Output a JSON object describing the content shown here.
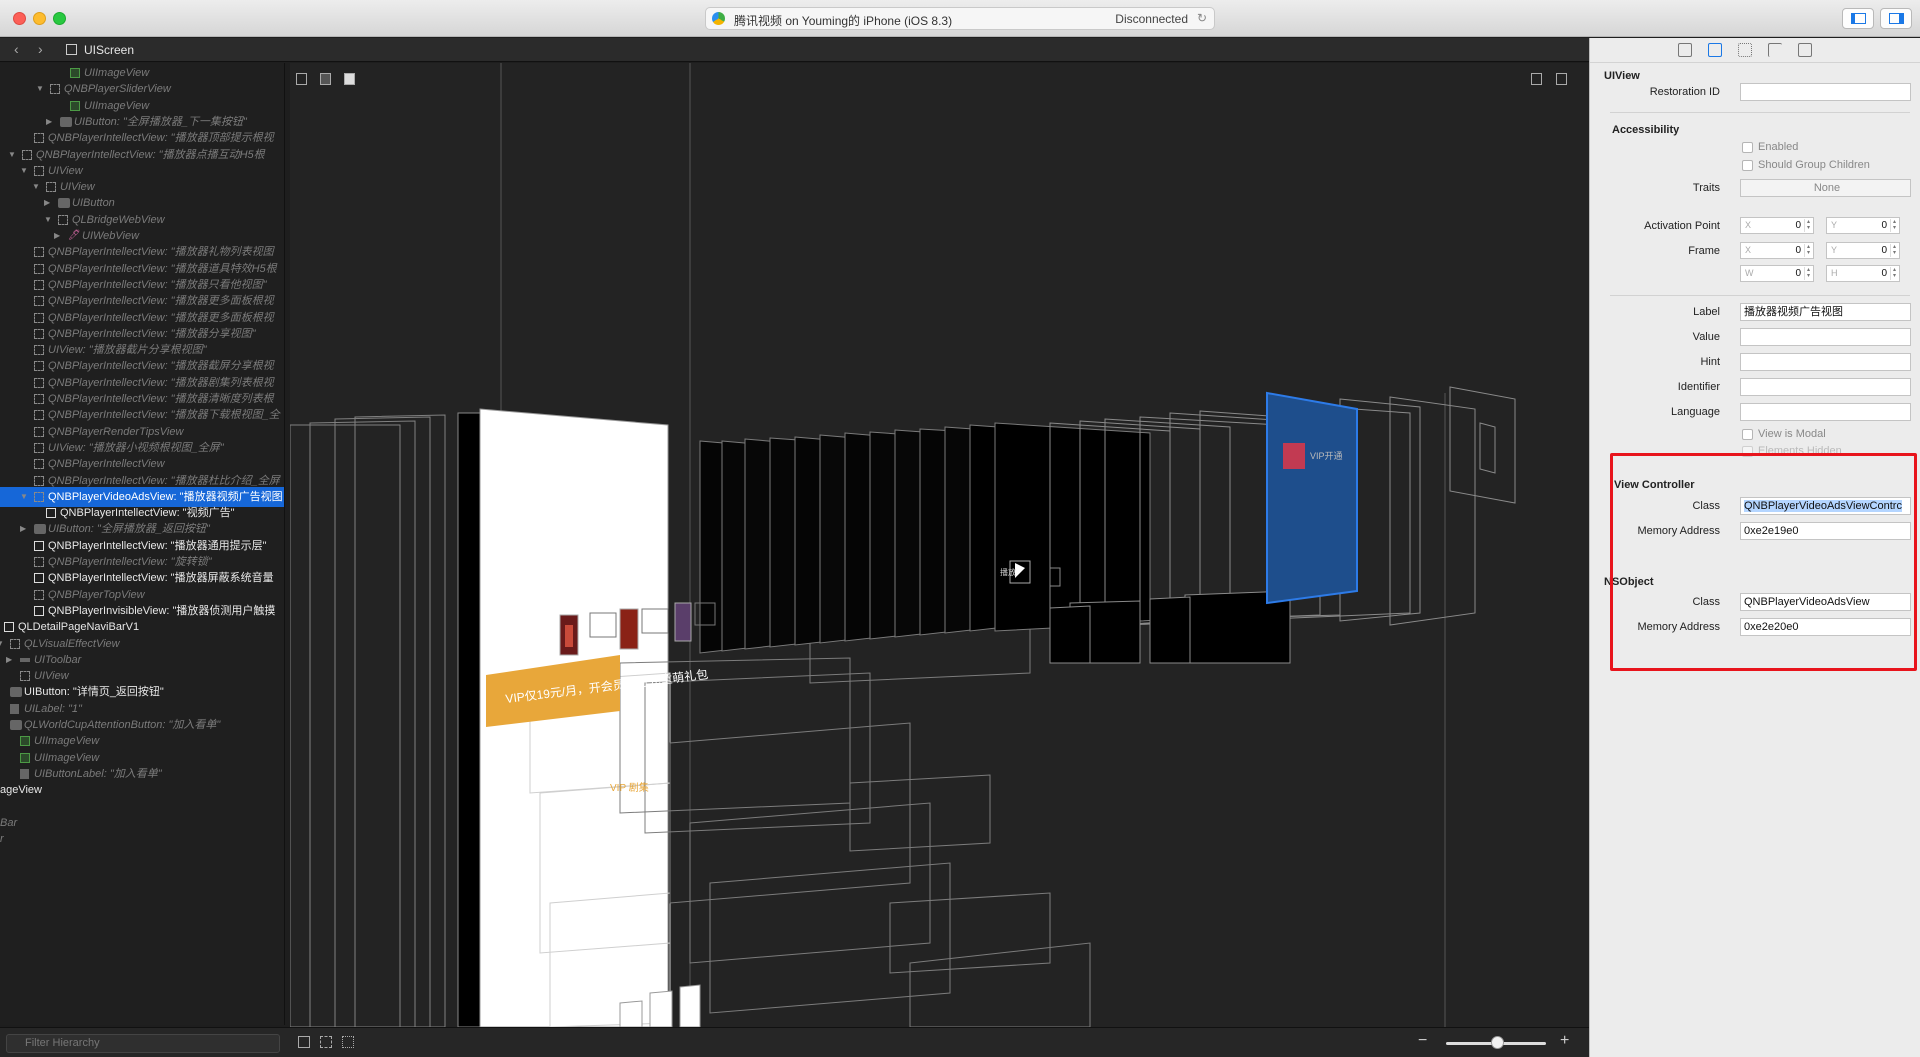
{
  "window": {
    "scheme": "腾讯视频 on Youming的 iPhone (iOS 8.3)",
    "status": "Disconnected"
  },
  "nav": {
    "back_icon": "chevron-left-icon",
    "forward_icon": "chevron-right-icon",
    "breadcrumb": "UIScreen"
  },
  "tree": {
    "rows": [
      {
        "label": "UIImageView",
        "style": "dim",
        "icon": "img"
      },
      {
        "label": "QNBPlayerSliderView",
        "style": "dim",
        "icon": "view"
      },
      {
        "label": "UIImageView",
        "style": "dim",
        "icon": "img"
      },
      {
        "label": "UIButton: \"全屏播放器_下一集按钮\"",
        "style": "dim",
        "icon": "btn"
      },
      {
        "label": "QNBPlayerIntellectView: \"播放器顶部提示根视",
        "style": "dim",
        "icon": "view"
      },
      {
        "label": "QNBPlayerIntellectView: \"播放器点播互动H5根",
        "style": "dim",
        "icon": "view"
      },
      {
        "label": "UIView",
        "style": "dim",
        "icon": "view"
      },
      {
        "label": "UIView",
        "style": "dim",
        "icon": "view"
      },
      {
        "label": "UIButton",
        "style": "dim",
        "icon": "btn"
      },
      {
        "label": "QLBridgeWebView",
        "style": "dim",
        "icon": "view"
      },
      {
        "label": "UIWebView",
        "style": "dim",
        "icon": "web"
      },
      {
        "label": "QNBPlayerIntellectView: \"播放器礼物列表视图",
        "style": "dim",
        "icon": "view"
      },
      {
        "label": "QNBPlayerIntellectView: \"播放器道具特效H5根",
        "style": "dim",
        "icon": "view"
      },
      {
        "label": "QNBPlayerIntellectView: \"播放器只看他视图\"",
        "style": "dim",
        "icon": "view"
      },
      {
        "label": "QNBPlayerIntellectView: \"播放器更多面板根视",
        "style": "dim",
        "icon": "view"
      },
      {
        "label": "QNBPlayerIntellectView: \"播放器更多面板根视",
        "style": "dim",
        "icon": "view"
      },
      {
        "label": "QNBPlayerIntellectView: \"播放器分享视图\"",
        "style": "dim",
        "icon": "view"
      },
      {
        "label": "UIView: \"播放器截片分享根视图\"",
        "style": "dim",
        "icon": "view"
      },
      {
        "label": "QNBPlayerIntellectView: \"播放器截屏分享根视",
        "style": "dim",
        "icon": "view"
      },
      {
        "label": "QNBPlayerIntellectView: \"播放器剧集列表根视",
        "style": "dim",
        "icon": "view"
      },
      {
        "label": "QNBPlayerIntellectView: \"播放器清晰度列表根",
        "style": "dim",
        "icon": "view"
      },
      {
        "label": "QNBPlayerIntellectView: \"播放器下载根视图_全",
        "style": "dim",
        "icon": "view"
      },
      {
        "label": "QNBPlayerRenderTipsView",
        "style": "dim",
        "icon": "view"
      },
      {
        "label": "UIView: \"播放器小视频根视图_全屏\"",
        "style": "dim",
        "icon": "view"
      },
      {
        "label": "QNBPlayerIntellectView",
        "style": "dim",
        "icon": "view"
      },
      {
        "label": "QNBPlayerIntellectView: \"播放器杜比介绍_全屏",
        "style": "dim",
        "icon": "view"
      },
      {
        "label": "QNBPlayerVideoAdsView: \"播放器视频广告视图",
        "style": "sel",
        "icon": "view"
      },
      {
        "label": "QNBPlayerIntellectView: \"视频广告\"",
        "style": "bright",
        "icon": "view"
      },
      {
        "label": "UIButton: \"全屏播放器_返回按钮\"",
        "style": "dim",
        "icon": "btn"
      },
      {
        "label": "QNBPlayerIntellectView: \"播放器通用提示层\"",
        "style": "bright",
        "icon": "view"
      },
      {
        "label": "QNBPlayerIntellectView: \"旋转锁\"",
        "style": "dim",
        "icon": "view"
      },
      {
        "label": "QNBPlayerIntellectView: \"播放器屏蔽系统音量",
        "style": "bright",
        "icon": "view"
      },
      {
        "label": "QNBPlayerTopView",
        "style": "dim",
        "icon": "view"
      },
      {
        "label": "QNBPlayerInvisibleView: \"播放器侦测用户触摸",
        "style": "bright",
        "icon": "view"
      },
      {
        "label": "QLDetailPageNaviBarV1",
        "style": "bright",
        "icon": "view"
      },
      {
        "label": "QLVisualEffectView",
        "style": "dim",
        "icon": "view"
      },
      {
        "label": "UIToolbar",
        "style": "dim",
        "icon": "bar"
      },
      {
        "label": "UIView",
        "style": "dim",
        "icon": "view"
      },
      {
        "label": "UIButton: \"详情页_返回按钮\"",
        "style": "bright",
        "icon": "btn"
      },
      {
        "label": "UILabel: \"1\"",
        "style": "dim",
        "icon": "lbl"
      },
      {
        "label": "QLWorldCupAttentionButton: \"加入看单\"",
        "style": "dim",
        "icon": "btn"
      },
      {
        "label": "UIImageView",
        "style": "dim",
        "icon": "img"
      },
      {
        "label": "UIImageView",
        "style": "dim",
        "icon": "img"
      },
      {
        "label": "UIButtonLabel: \"加入看单\"",
        "style": "dim",
        "icon": "lbl"
      },
      {
        "label": "ageView",
        "style": "bright",
        "icon": "none"
      },
      {
        "label": "",
        "style": "dim",
        "icon": "none"
      },
      {
        "label": "Bar",
        "style": "dim",
        "icon": "none"
      },
      {
        "label": "r",
        "style": "dim",
        "icon": "none"
      }
    ],
    "filter_placeholder": "Filter Hierarchy"
  },
  "canvas": {
    "banner_text": "VIP仅19元/月，开会员赢万元童萌礼包",
    "mini_label_1": "VIP开通",
    "mini_label_2": "播放",
    "mini_label_3": "VIP 剧集",
    "zoom_level": 0.5
  },
  "inspector": {
    "uiview": {
      "title": "UIView",
      "restoration_id_label": "Restoration ID",
      "restoration_id": ""
    },
    "accessibility": {
      "title": "Accessibility",
      "enabled_label": "Enabled",
      "group_label": "Should Group Children",
      "traits_label": "Traits",
      "traits_value": "None",
      "activation_label": "Activation Point",
      "activation_x": "0",
      "activation_y": "0",
      "frame_label": "Frame",
      "frame_x": "0",
      "frame_y": "0",
      "frame_w": "0",
      "frame_h": "0",
      "key_x": "X",
      "key_y": "Y",
      "key_w": "W",
      "key_h": "H",
      "label_label": "Label",
      "label_value": "播放器视频广告视图",
      "value_label": "Value",
      "hint_label": "Hint",
      "identifier_label": "Identifier",
      "language_label": "Language",
      "modal_label": "View is Modal",
      "hidden_label": "Elements Hidden"
    },
    "view_controller": {
      "title": "View Controller",
      "class_label": "Class",
      "class_value": "QNBPlayerVideoAdsViewContrc",
      "mem_label": "Memory Address",
      "mem_value": "0xe2e19e0"
    },
    "nsobject": {
      "title": "NSObject",
      "class_label": "Class",
      "class_value": "QNBPlayerVideoAdsView",
      "mem_label": "Memory Address",
      "mem_value": "0xe2e20e0"
    }
  },
  "colors": {
    "selection": "#1667d8",
    "highlight_box": "#e8141c",
    "selected_layer": "#2d7be8"
  }
}
